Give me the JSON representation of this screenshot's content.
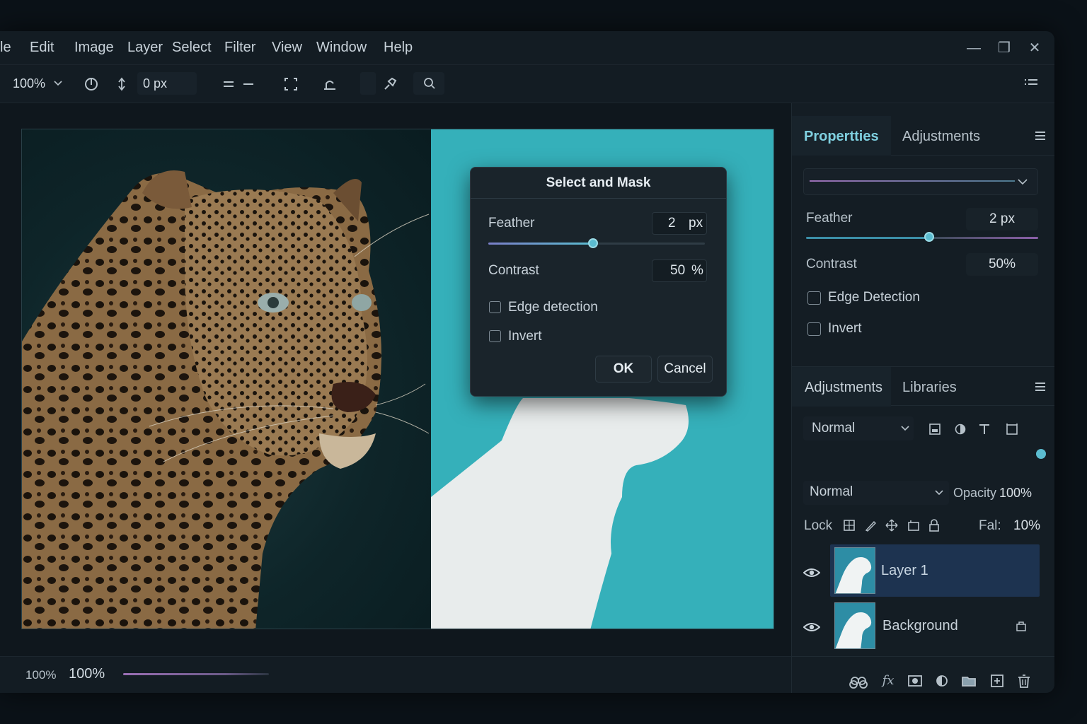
{
  "menu": [
    "le",
    "Edit",
    "Image",
    "Layer",
    "Select",
    "Filter",
    "View",
    "Window",
    "Help"
  ],
  "window_controls": {
    "minimize": "—",
    "maximize": "❐",
    "close": "✕"
  },
  "toolbar": {
    "zoom": "100%",
    "feather_value": "0 px"
  },
  "dialog": {
    "title": "Select and Mask",
    "feather_label": "Feather",
    "feather_value": "2",
    "feather_unit": "px",
    "contrast_label": "Contrast",
    "contrast_value": "50",
    "contrast_unit": "%",
    "edge_detection_label": "Edge detection",
    "invert_label": "Invert",
    "ok_label": "OK",
    "cancel_label": "Cancel"
  },
  "properties": {
    "tab_active": "Propertties",
    "tab_other": "Adjustments",
    "feather_label": "Feather",
    "feather_value": "2 px",
    "contrast_label": "Contrast",
    "contrast_value": "50%",
    "edge_detection_label": "Edge Detection",
    "invert_label": "Invert"
  },
  "layers_panel": {
    "tab_active": "Adjustments",
    "tab_other": "Libraries",
    "blend_top": "Normal",
    "blend_mode": "Normal",
    "opacity_label": "Opacity",
    "opacity_value": "100%",
    "lock_label": "Lock",
    "fill_label": "Fal:",
    "fill_value": "10%",
    "layers": [
      {
        "name": "Layer 1",
        "selected": true
      },
      {
        "name": "Background",
        "selected": false
      }
    ]
  },
  "status": {
    "zoom_small": "100%",
    "zoom_large": "100%"
  },
  "colors": {
    "accent": "#5bbcd0",
    "mask_bg": "#35b0ba",
    "selected_layer": "#1d3350"
  }
}
